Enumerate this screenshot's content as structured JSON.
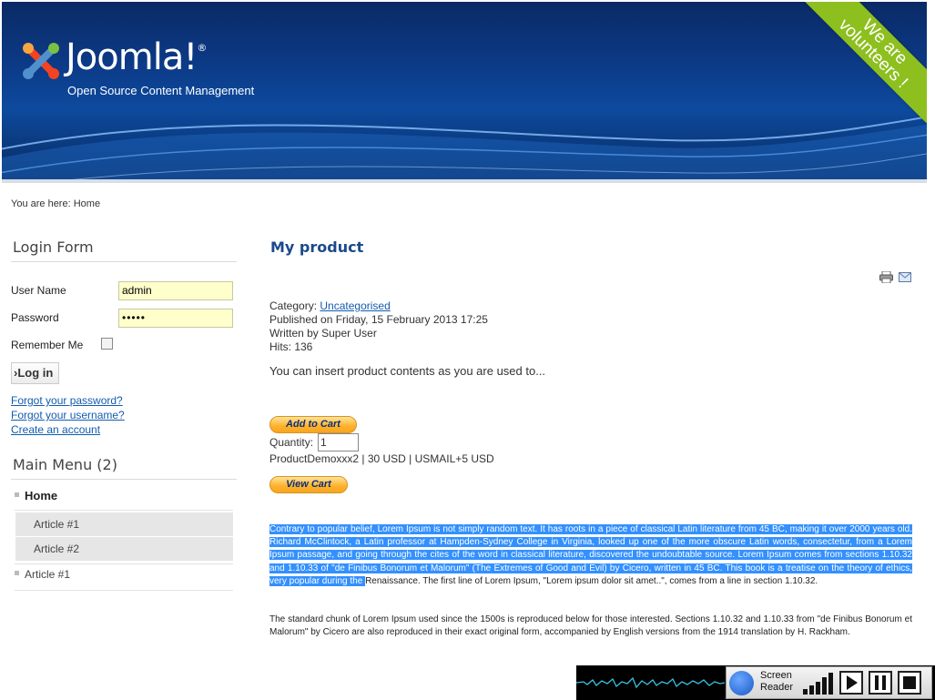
{
  "header": {
    "logo_text": "Joomla!",
    "tagline": "Open Source Content Management",
    "ribbon_line1": "We are",
    "ribbon_line2": "volunteers !"
  },
  "breadcrumb": {
    "prefix": "You are here:",
    "current": "Home"
  },
  "login": {
    "title": "Login Form",
    "username_label": "User Name",
    "username_value": "admin",
    "password_label": "Password",
    "password_value": "•••••",
    "remember_label": "Remember Me",
    "login_button": "›Log in",
    "forgot_password": "Forgot your password?",
    "forgot_username": "Forgot your username?",
    "create_account": "Create an account"
  },
  "main_menu": {
    "title": "Main Menu (2)",
    "home": "Home",
    "sub_items": [
      "Article #1",
      "Article #2"
    ],
    "item": "Article #1"
  },
  "article": {
    "title": "My product",
    "category_label": "Category:",
    "category_value": "Uncategorised",
    "published": "Published on Friday, 15 February 2013 17:25",
    "written_by": "Written by Super User",
    "hits": "Hits: 136",
    "intro": "You can insert product contents as you are used to...",
    "add_to_cart": "Add to Cart",
    "quantity_label": "Quantity:",
    "quantity_value": "1",
    "product_line": "ProductDemoxxx2 | 30 USD | USMAIL+5 USD",
    "view_cart": "View Cart",
    "para1_selected": "Contrary to popular belief, Lorem Ipsum is not simply random text. It has roots in a piece of classical Latin literature from 45 BC, making it over 2000 years old. Richard McClintock, a Latin professor at Hampden-Sydney College in Virginia, looked up one of the more obscure Latin words, consectetur, from a Lorem Ipsum passage, and going through the cites of the word in classical literature, discovered the undoubtable source. Lorem Ipsum comes from sections 1.10.32 and 1.10.33 of \"de Finibus Bonorum et Malorum\" (The Extremes of Good and Evil) by Cicero, written in 45 BC. This book is a treatise on the theory of ethics, very popular during the ",
    "para1_rest": "Renaissance. The first line of Lorem Ipsum, \"Lorem ipsum dolor sit amet..\", comes from a line in section 1.10.32.",
    "para2": "The standard chunk of Lorem Ipsum used since the 1500s is reproduced below for those interested. Sections 1.10.32 and 1.10.33 from \"de Finibus Bonorum et Malorum\" by Cicero are also reproduced in their exact original form, accompanied by English versions from the 1914 translation by H. Rackham."
  },
  "screen_reader": {
    "line1": "Screen",
    "line2": "Reader"
  },
  "colors": {
    "header_blue": "#0c3a86",
    "ribbon_green": "#8dbf1f",
    "link_blue": "#135cae",
    "field_yellow": "#ffffcc",
    "selection": "#3390ff"
  }
}
